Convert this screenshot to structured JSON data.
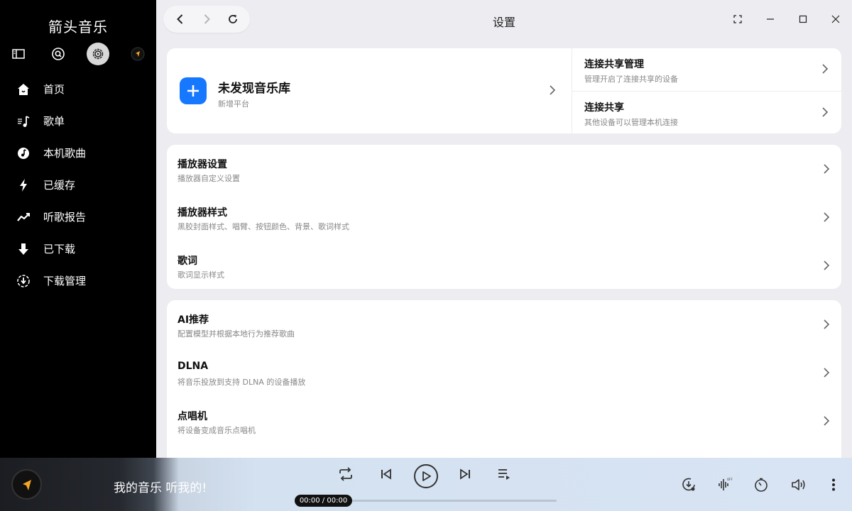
{
  "window": {
    "title": "设置"
  },
  "sidebar": {
    "app_name": "箭头音乐",
    "top_icons": [
      "sidebar-toggle-icon",
      "search-icon",
      "settings-icon",
      "user-avatar-icon"
    ],
    "items": [
      {
        "label": "首页",
        "icon": "home-icon"
      },
      {
        "label": "歌单",
        "icon": "playlist-icon"
      },
      {
        "label": "本机歌曲",
        "icon": "local-music-icon"
      },
      {
        "label": "已缓存",
        "icon": "cache-bolt-icon"
      },
      {
        "label": "听歌报告",
        "icon": "trend-chart-icon"
      },
      {
        "label": "已下载",
        "icon": "download-arrow-icon"
      },
      {
        "label": "下载管理",
        "icon": "download-manager-icon"
      }
    ]
  },
  "library_card": {
    "title": "未发现音乐库",
    "subtitle": "新增平台"
  },
  "share_items": [
    {
      "title": "连接共享管理",
      "subtitle": "管理开启了连接共享的设备"
    },
    {
      "title": "连接共享",
      "subtitle": "其他设备可以管理本机连接"
    }
  ],
  "player_settings": [
    {
      "title": "播放器设置",
      "subtitle": "播放器自定义设置"
    },
    {
      "title": "播放器样式",
      "subtitle": "黑胶封面样式、唱臂、按钮颜色、背景、歌词样式"
    },
    {
      "title": "歌词",
      "subtitle": "歌词显示样式"
    }
  ],
  "extra_settings": [
    {
      "title": "AI推荐",
      "subtitle": "配置模型并根据本地行为推荐歌曲"
    },
    {
      "title": "DLNA",
      "subtitle": "将音乐投放到支持 DLNA 的设备播放"
    },
    {
      "title": "点唱机",
      "subtitle": "将设备变成音乐点唱机"
    }
  ],
  "player": {
    "slogan": "我的音乐 听我的!",
    "time": "00:00 / 00:00",
    "progress": 0
  },
  "colors": {
    "accent": "#1677ff",
    "sidebar_bg": "#000000",
    "logo_orange": "#f5a623"
  }
}
